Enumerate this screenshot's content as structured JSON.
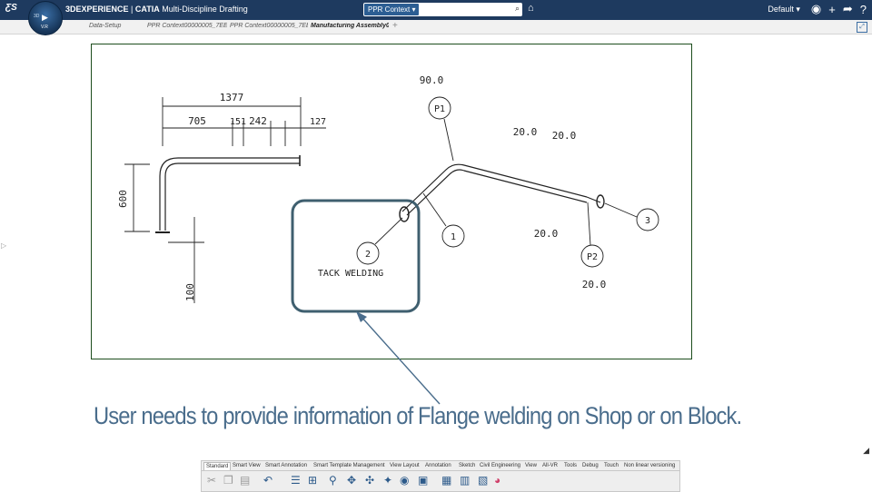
{
  "header": {
    "brand_bold": "3DEXPERIENCE",
    "brand_sep": " | ",
    "brand_app": "CATIA",
    "brand_module": "Multi-Discipline Drafting",
    "ds_logo": "ƸS",
    "compass_label_3d": "3D",
    "compass_version": "V.R",
    "search_context": "PPR Context ▾",
    "search_placeholder": "",
    "search_icon": "⌕",
    "profile_label": "Default ▾",
    "icons": [
      "user-icon",
      "add-icon",
      "share-icon",
      "help-icon"
    ]
  },
  "tabs": [
    {
      "label": "Data-Setup",
      "active": false
    },
    {
      "label": "PPR Context00000005_7EE",
      "active": false
    },
    {
      "label": "PPR Context00000005_7EE",
      "active": false
    },
    {
      "label": "Manufacturing Assembly0",
      "active": true
    }
  ],
  "tab_add": "+",
  "drawing": {
    "dim_1377": "1377",
    "dim_705": "705",
    "dim_151": "151",
    "dim_242": "242",
    "dim_127": "127",
    "dim_600": "600",
    "dim_100": "100",
    "angle_90": "90.0",
    "angle_20a": "20.0",
    "angle_20b": "20.0",
    "angle_20c": "20.0",
    "angle_20d": "20.0",
    "balloon_p1": "P1",
    "balloon_p2": "P2",
    "balloon_1": "1",
    "balloon_2": "2",
    "balloon_3": "3",
    "note": "TACK WELDING"
  },
  "caption": "User needs to provide information of Flange welding on Shop or on Block.",
  "toolbar": {
    "tabs": [
      "Standard",
      "Smart View",
      "Smart Annotation",
      "Smart Template Management",
      "View Layout",
      "Annotation",
      "Sketch",
      "Civil Engineering",
      "View",
      "All-VR",
      "Tools",
      "Debug",
      "Touch",
      "Non linear versioning"
    ],
    "active_tab": "Standard"
  },
  "colors": {
    "topbar": "#1e3a5f",
    "frame": "#1d4d1d",
    "callout": "#3f5f6f",
    "caption": "#4a6d8c"
  }
}
